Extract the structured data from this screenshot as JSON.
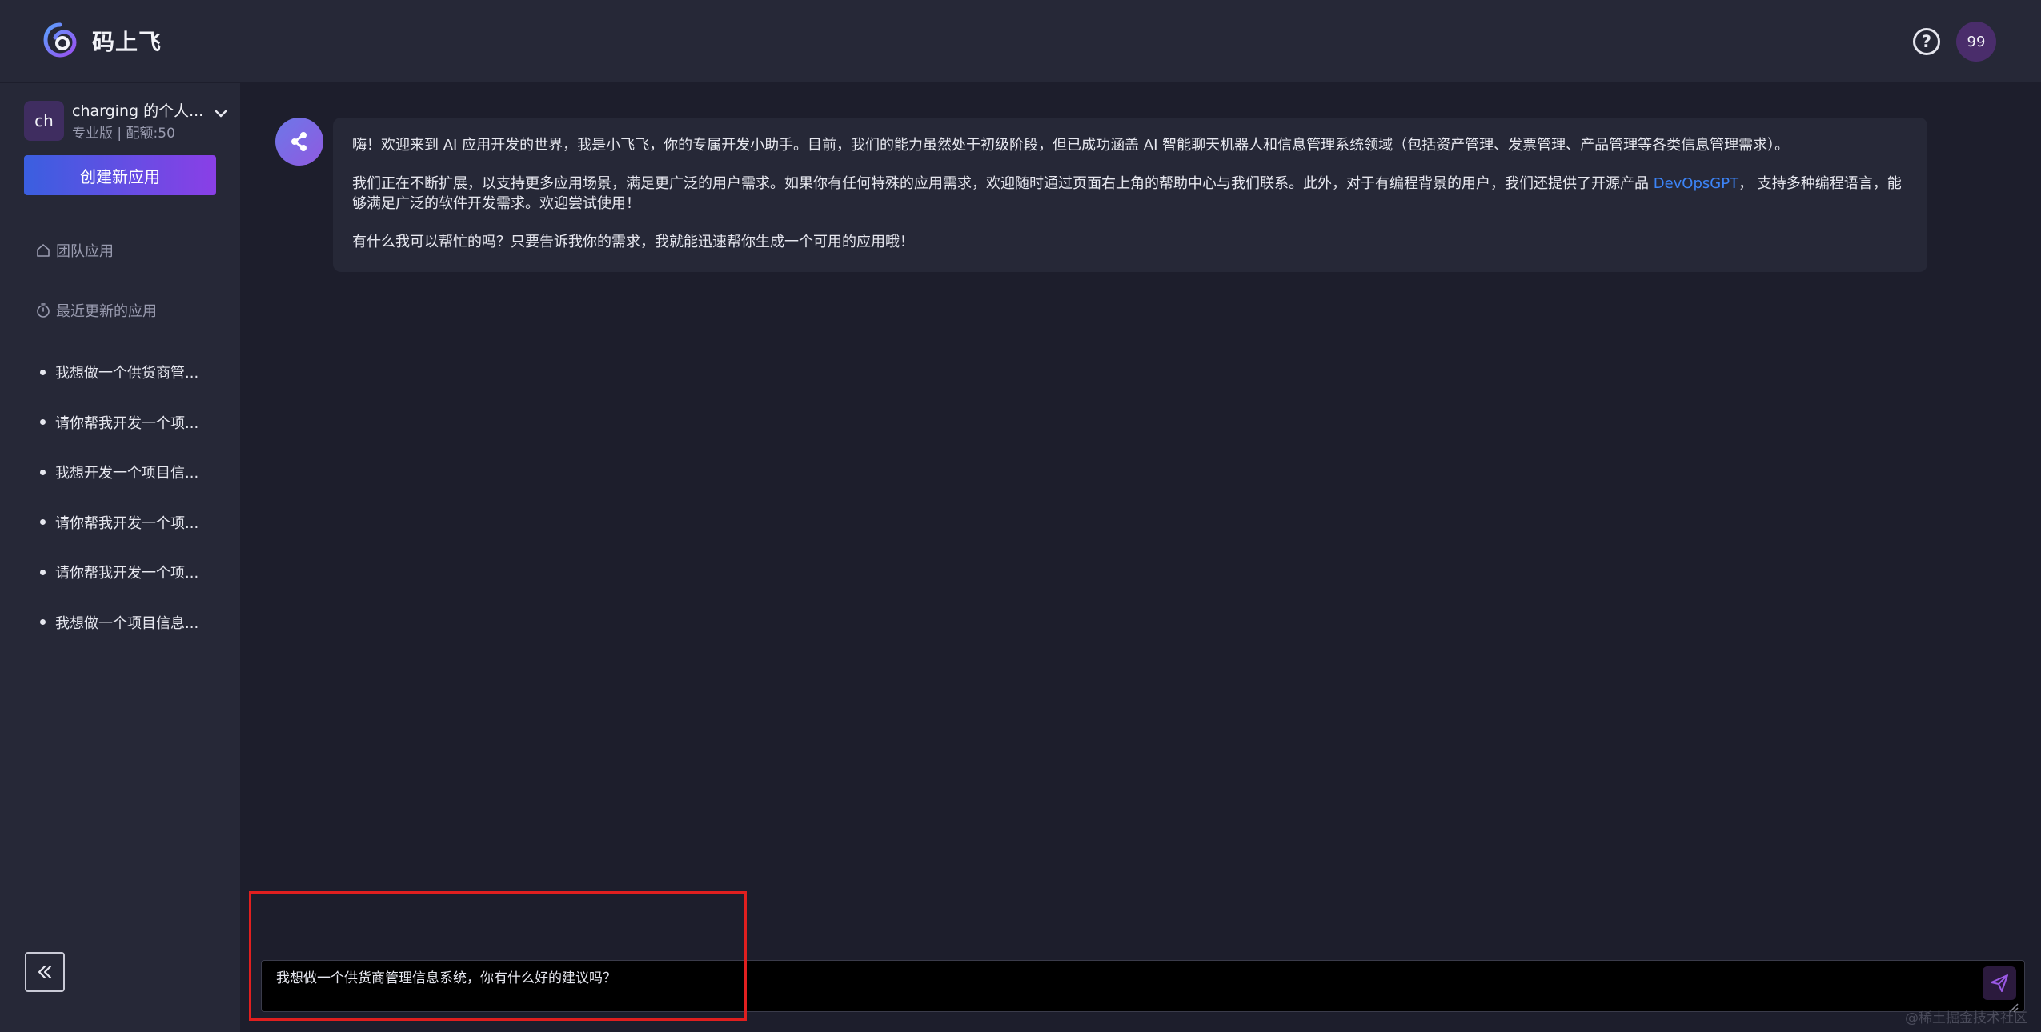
{
  "header": {
    "brand": "码上飞",
    "avatar_text": "99"
  },
  "sidebar": {
    "account": {
      "avatar_text": "ch",
      "name": "charging 的个人...",
      "plan": "专业版 | 配额:50"
    },
    "create_label": "创建新应用",
    "team_apps_label": "团队应用",
    "recent_label": "最近更新的应用",
    "recent_items": [
      "我想做一个供货商管...",
      "请你帮我开发一个项...",
      "我想开发一个项目信...",
      "请你帮我开发一个项...",
      "请你帮我开发一个项...",
      "我想做一个项目信息..."
    ]
  },
  "chat": {
    "messages": [
      {
        "p1": "嗨！欢迎来到 AI 应用开发的世界，我是小飞飞，你的专属开发小助手。目前，我们的能力虽然处于初级阶段，但已成功涵盖 AI 智能聊天机器人和信息管理系统领域（包括资产管理、发票管理、产品管理等各类信息管理需求）。",
        "p2_before": "我们正在不断扩展，以支持更多应用场景，满足更广泛的用户需求。如果你有任何特殊的应用需求，欢迎随时通过页面右上角的帮助中心与我们联系。此外，对于有编程背景的用户，我们还提供了开源产品 ",
        "p2_link": "DevOpsGPT",
        "p2_after": "， 支持多种编程语言，能够满足广泛的软件开发需求。欢迎尝试使用！",
        "p3": "有什么我可以帮忙的吗？只要告诉我你的需求，我就能迅速帮你生成一个可用的应用哦！"
      }
    ]
  },
  "input": {
    "value": "我想做一个供货商管理信息系统，你有什么好的建议吗？"
  },
  "watermark": "@稀土掘金技术社区"
}
